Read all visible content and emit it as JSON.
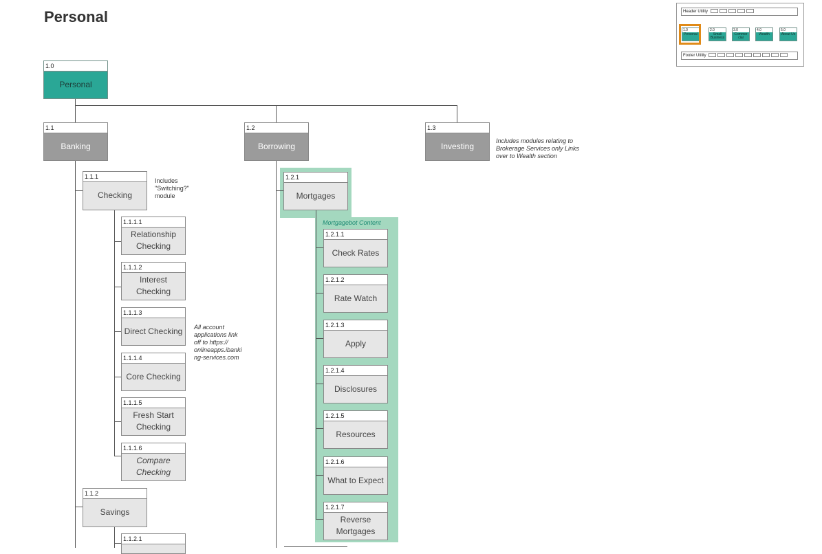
{
  "page": {
    "title": "Personal"
  },
  "nodes": {
    "n1_0": {
      "num": "1.0",
      "label": "Personal"
    },
    "n1_1": {
      "num": "1.1",
      "label": "Banking"
    },
    "n1_2": {
      "num": "1.2",
      "label": "Borrowing"
    },
    "n1_3": {
      "num": "1.3",
      "label": "Investing"
    },
    "n1_1_1": {
      "num": "1.1.1",
      "label": "Checking"
    },
    "n1_1_1_1": {
      "num": "1.1.1.1",
      "label": "Relationship Checking"
    },
    "n1_1_1_2": {
      "num": "1.1.1.2",
      "label": "Interest Checking"
    },
    "n1_1_1_3": {
      "num": "1.1.1.3",
      "label": "Direct Checking"
    },
    "n1_1_1_4": {
      "num": "1.1.1.4",
      "label": "Core Checking"
    },
    "n1_1_1_5": {
      "num": "1.1.1.5",
      "label": "Fresh Start Checking"
    },
    "n1_1_1_6": {
      "num": "1.1.1.6",
      "label": "Compare Checking"
    },
    "n1_1_2": {
      "num": "1.1.2",
      "label": "Savings"
    },
    "n1_1_2_1": {
      "num": "1.1.2.1",
      "label": ""
    },
    "n1_2_1": {
      "num": "1.2.1",
      "label": "Mortgages"
    },
    "n1_2_1_1": {
      "num": "1.2.1.1",
      "label": "Check Rates"
    },
    "n1_2_1_2": {
      "num": "1.2.1.2",
      "label": "Rate Watch"
    },
    "n1_2_1_3": {
      "num": "1.2.1.3",
      "label": "Apply"
    },
    "n1_2_1_4": {
      "num": "1.2.1.4",
      "label": "Disclosures"
    },
    "n1_2_1_5": {
      "num": "1.2.1.5",
      "label": "Resources"
    },
    "n1_2_1_6": {
      "num": "1.2.1.6",
      "label": "What to Expect"
    },
    "n1_2_1_7": {
      "num": "1.2.1.7",
      "label": "Reverse Mortgages"
    }
  },
  "notes": {
    "investing": "Includes modules relating to Brokerage Services only Links over to Wealth section",
    "checking": "Includes \"Switching?\" module",
    "applications": "All account applications link off to https:// onlineapps.ibanki ng-services.com",
    "mortgagebot": "Mortgagebot Content"
  },
  "mini_map": {
    "header": "Header Utility",
    "footer": "Footer Utility",
    "sections": [
      {
        "num": "1.0",
        "label": "Personal"
      },
      {
        "num": "2.0",
        "label": "Small Business"
      },
      {
        "num": "3.0",
        "label": "Commer cial"
      },
      {
        "num": "4.0",
        "label": "Wealth"
      },
      {
        "num": "5.0",
        "label": "About Us"
      }
    ]
  },
  "colors": {
    "teal": "#2aa796",
    "gray": "#9b9b9b",
    "light": "#e6e6e6",
    "highlight": "#a4d8bf",
    "selection": "#e08a18"
  }
}
